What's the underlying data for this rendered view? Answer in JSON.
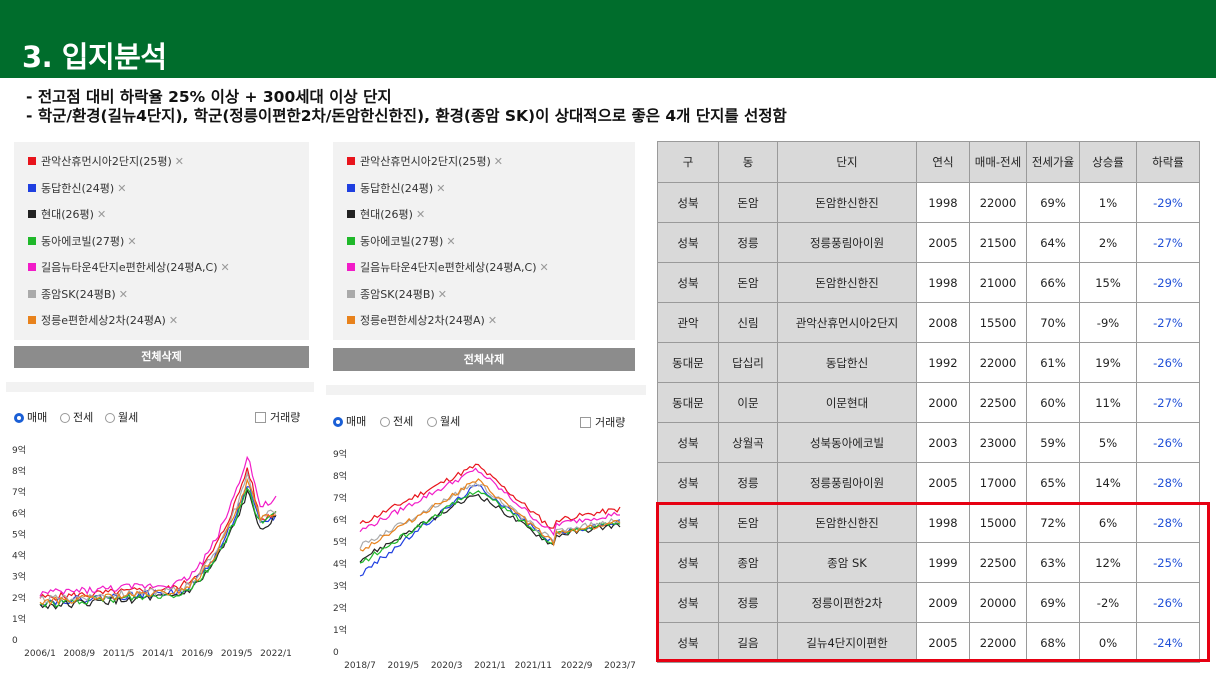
{
  "header": {
    "title": "3. 입지분석"
  },
  "bullets": [
    "- 전고점 대비 하락율 25% 이상 + 300세대 이상 단지",
    "- 학군/환경(길뉴4단지), 학군(정릉이편한2차/돈암한신한진), 환경(종암 SK)이 상대적으로 좋은 4개 단지를 선정함"
  ],
  "legend": [
    {
      "label": "관악산휴먼시아2단지(25평)",
      "color": "#e8141c"
    },
    {
      "label": "동답한신(24평)",
      "color": "#1f3fe0"
    },
    {
      "label": "현대(26평)",
      "color": "#222222"
    },
    {
      "label": "동아에코빌(27평)",
      "color": "#1fb82a"
    },
    {
      "label": "길음뉴타운4단지e편한세상(24평A,C)",
      "color": "#f21cc8"
    },
    {
      "label": "종암SK(24평B)",
      "color": "#aaaaaa"
    },
    {
      "label": "정릉e편한세상2차(24평A)",
      "color": "#e8821c"
    }
  ],
  "remove_symbol": "✕",
  "clear_all_label": "전체삭제",
  "radios": {
    "sale": "매매",
    "jeonse": "전세",
    "monthly": "월세",
    "volume": "거래량"
  },
  "chart_left": {
    "y_ticks": [
      "9억",
      "8억",
      "7억",
      "6억",
      "5억",
      "4억",
      "3억",
      "2억",
      "1억",
      "0"
    ],
    "x_ticks": [
      "2006/1",
      "2008/9",
      "2011/5",
      "2014/1",
      "2016/9",
      "2019/5",
      "2022/1"
    ]
  },
  "chart_right": {
    "y_ticks": [
      "9억",
      "8억",
      "7억",
      "6억",
      "5억",
      "4억",
      "3억",
      "2억",
      "1억",
      "0"
    ],
    "x_ticks": [
      "2018/7",
      "2019/5",
      "2020/3",
      "2021/1",
      "2021/11",
      "2022/9",
      "2023/7"
    ]
  },
  "table": {
    "headers": [
      "구",
      "동",
      "단지",
      "연식",
      "매매-전세",
      "전세가율",
      "상승률",
      "하락률"
    ],
    "rows": [
      [
        "성북",
        "돈암",
        "돈암한신한진",
        "1998",
        "22000",
        "69%",
        "1%",
        "-29%"
      ],
      [
        "성북",
        "정릉",
        "정릉풍림아이원",
        "2005",
        "21500",
        "64%",
        "2%",
        "-27%"
      ],
      [
        "성북",
        "돈암",
        "돈암한신한진",
        "1998",
        "21000",
        "66%",
        "15%",
        "-29%"
      ],
      [
        "관악",
        "신림",
        "관악산휴먼시아2단지",
        "2008",
        "15500",
        "70%",
        "-9%",
        "-27%"
      ],
      [
        "동대문",
        "답십리",
        "동답한신",
        "1992",
        "22000",
        "61%",
        "19%",
        "-26%"
      ],
      [
        "동대문",
        "이문",
        "이문현대",
        "2000",
        "22500",
        "60%",
        "11%",
        "-27%"
      ],
      [
        "성북",
        "상월곡",
        "성북동아에코빌",
        "2003",
        "23000",
        "59%",
        "5%",
        "-26%"
      ],
      [
        "성북",
        "정릉",
        "정릉풍림아이원",
        "2005",
        "17000",
        "65%",
        "14%",
        "-28%"
      ],
      [
        "성북",
        "돈암",
        "돈암한신한진",
        "1998",
        "15000",
        "72%",
        "6%",
        "-28%"
      ],
      [
        "성북",
        "종암",
        "종암 SK",
        "1999",
        "22500",
        "63%",
        "12%",
        "-25%"
      ],
      [
        "성북",
        "정릉",
        "정릉이편한2차",
        "2009",
        "20000",
        "69%",
        "-2%",
        "-26%"
      ],
      [
        "성북",
        "길음",
        "길뉴4단지이편한",
        "2005",
        "22000",
        "68%",
        "0%",
        "-24%"
      ]
    ]
  }
}
